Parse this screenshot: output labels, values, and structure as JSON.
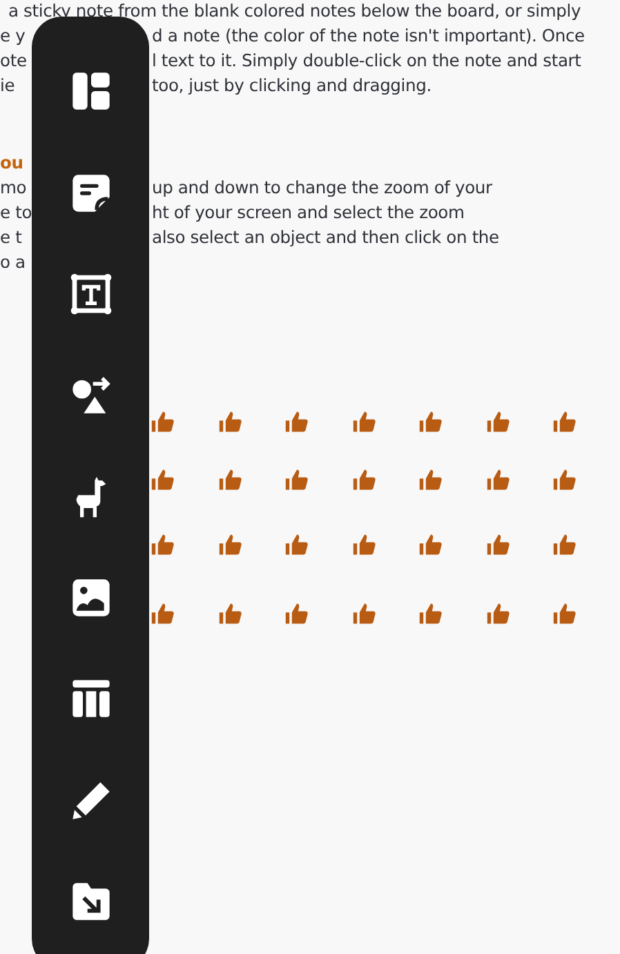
{
  "intro": {
    "first_line": "a sticky note from the blank colored notes below the board, or simply",
    "lines": [
      {
        "left": "e y",
        "right": "d a note (the color of the note isn't important). Once"
      },
      {
        "left": "ote",
        "right": "l text to it. Simply double-click on the note and start"
      },
      {
        "left": "ie",
        "right": "too, just by clicking and dragging."
      }
    ]
  },
  "zoom_section": {
    "heading": "ou",
    "lines": [
      {
        "left": "mo",
        "right": "up and down to change the zoom of your"
      },
      {
        "left": "e to",
        "right": "ht of your screen and select the zoom"
      },
      {
        "left": "e t",
        "right": "also select an object and then click on the"
      },
      {
        "left": "o a"
      }
    ]
  },
  "tools": [
    {
      "kind": "layout"
    },
    {
      "kind": "note"
    },
    {
      "kind": "text"
    },
    {
      "kind": "shapes"
    },
    {
      "kind": "llama"
    },
    {
      "kind": "image"
    },
    {
      "kind": "table"
    },
    {
      "kind": "pencil"
    },
    {
      "kind": "import"
    }
  ]
}
